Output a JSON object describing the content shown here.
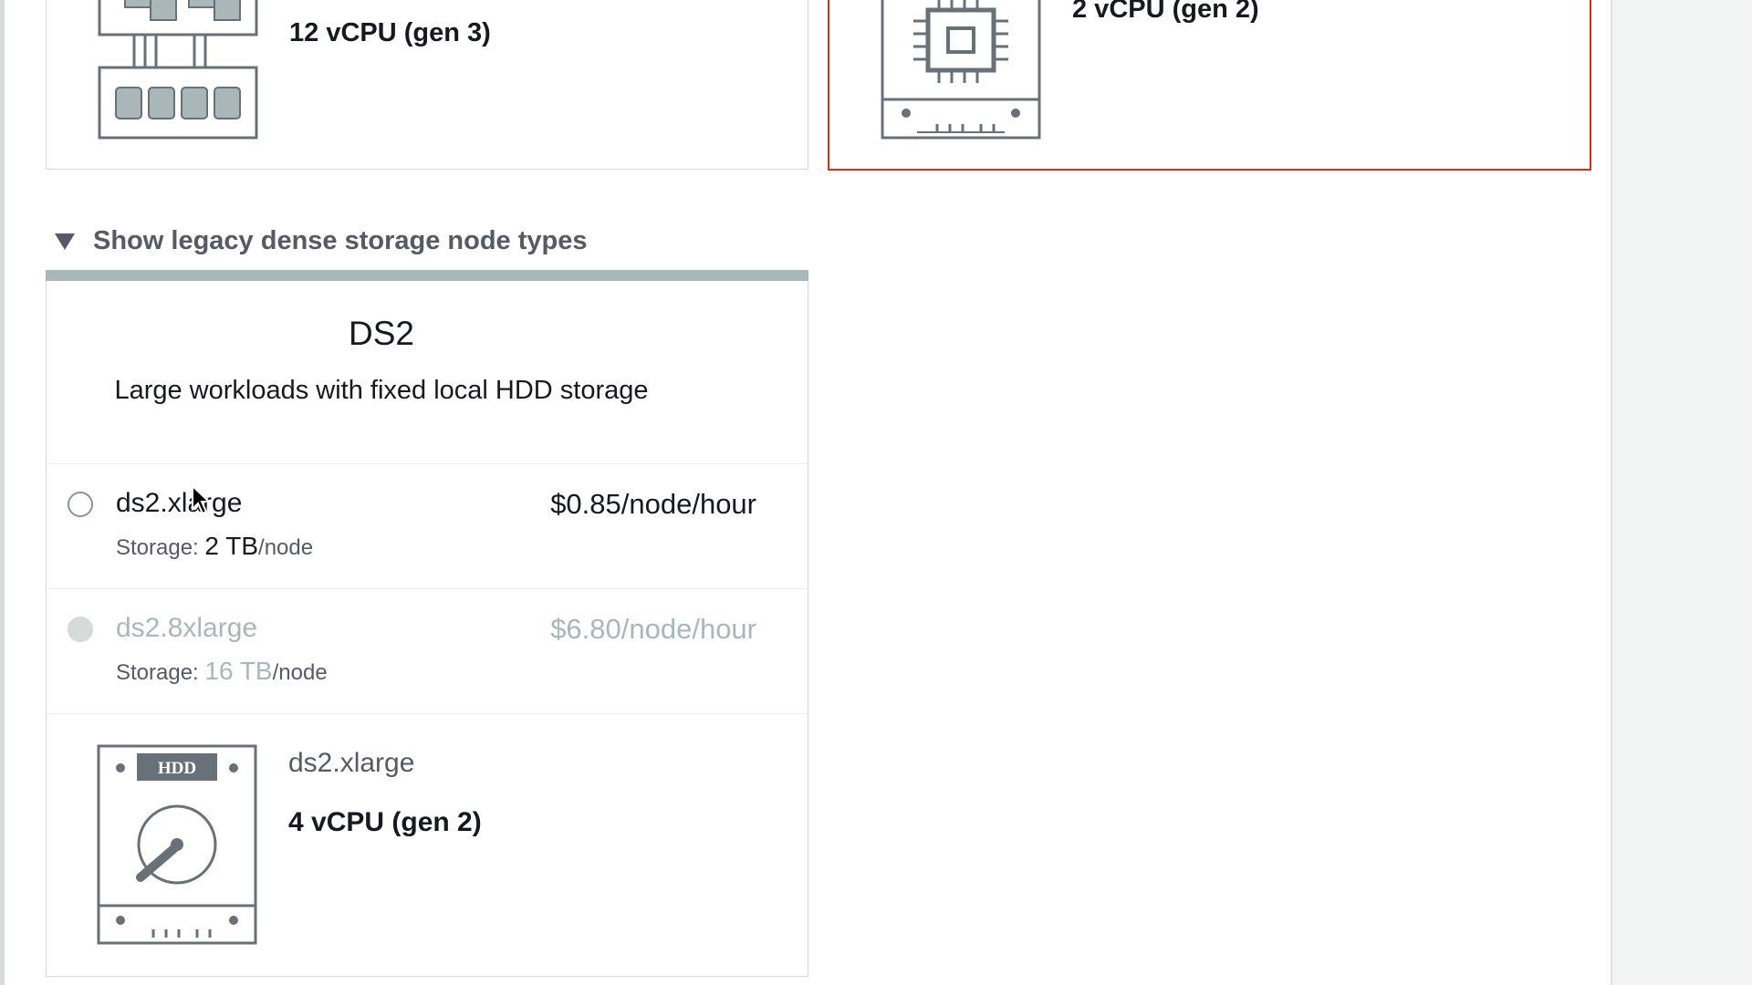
{
  "top_cards": [
    {
      "cpu_label": "12 vCPU (gen 3)",
      "icon": "ra3-node-icon",
      "selected": false
    },
    {
      "cpu_label": "2 vCPU (gen 2)",
      "icon": "cpu-chip-icon",
      "selected": true
    }
  ],
  "legacy_toggle": {
    "label": "Show legacy dense storage node types",
    "expanded": true
  },
  "ds2_card": {
    "title": "DS2",
    "description": "Large workloads with fixed local HDD storage",
    "options": [
      {
        "name": "ds2.xlarge",
        "price": "$0.85/node/hour",
        "storage_label": "Storage:",
        "storage_value": "2 TB",
        "storage_unit": "/node",
        "enabled": true,
        "selected": false
      },
      {
        "name": "ds2.8xlarge",
        "price": "$6.80/node/hour",
        "storage_label": "Storage:",
        "storage_value": "16 TB",
        "storage_unit": "/node",
        "enabled": false,
        "selected": false
      }
    ],
    "summary": {
      "icon_badge": "HDD",
      "icon": "hdd-icon",
      "name": "ds2.xlarge",
      "cpu": "4 vCPU (gen 2)"
    }
  },
  "colors": {
    "selected_border": "#d13212",
    "divider": "#d5dbdb",
    "muted_text": "#545b64",
    "disabled_text": "#aab7b8",
    "header_bar": "#aab7b8"
  }
}
